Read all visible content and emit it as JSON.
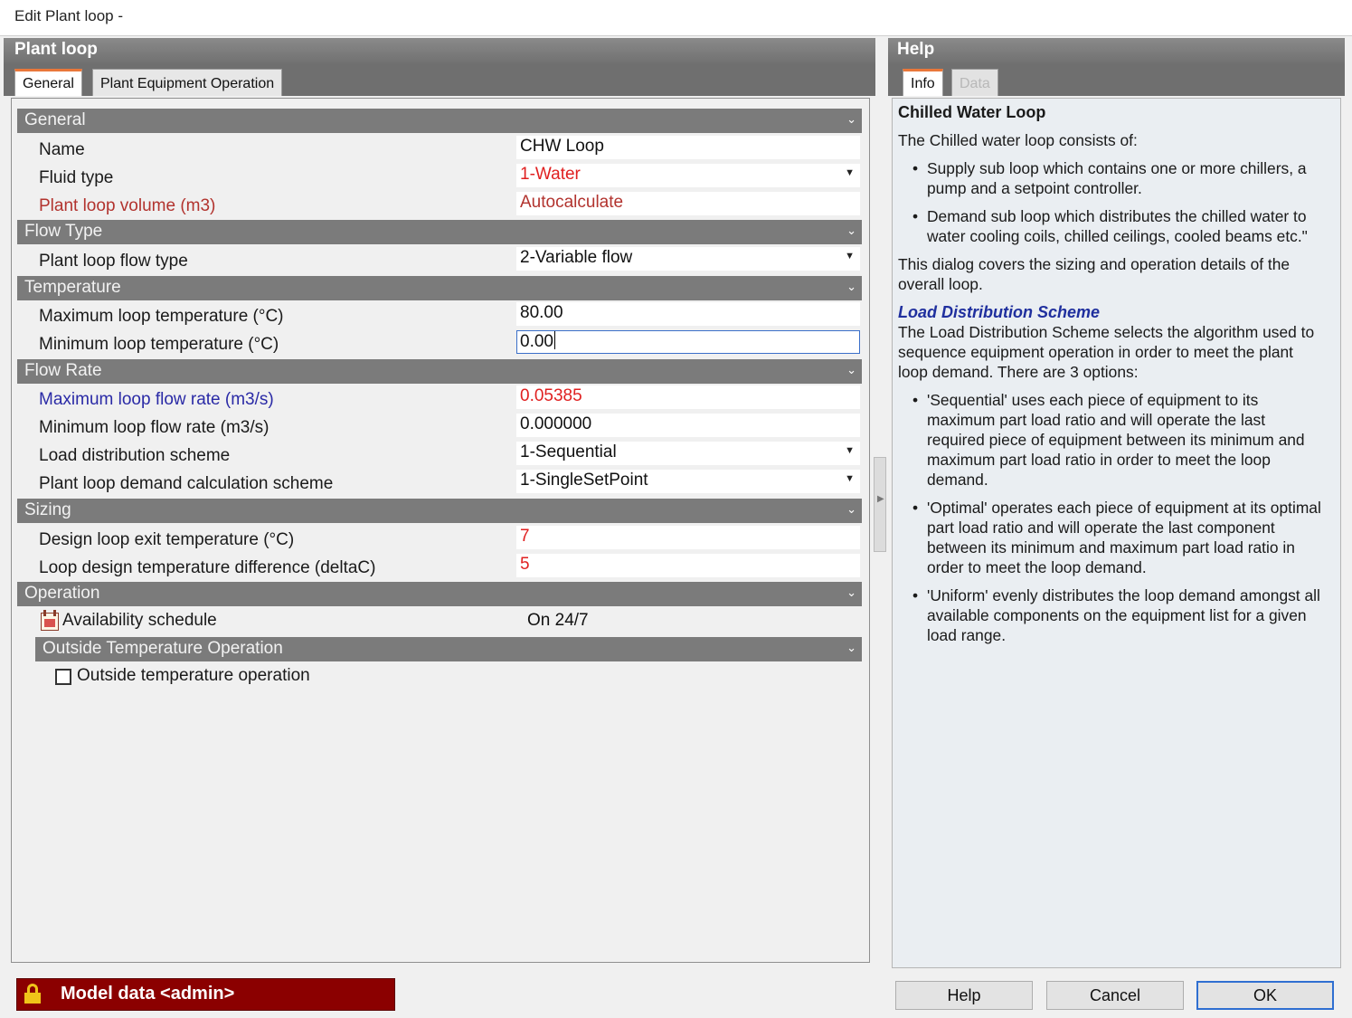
{
  "window": {
    "title": "Edit Plant loop -"
  },
  "left_pane": {
    "header": "Plant loop",
    "tabs": [
      {
        "label": "General",
        "active": true
      },
      {
        "label": "Plant Equipment Operation",
        "active": false
      }
    ]
  },
  "form": {
    "general": {
      "title": "General",
      "name": {
        "label": "Name",
        "value": "CHW Loop"
      },
      "fluid_type": {
        "label": "Fluid type",
        "value": "1-Water"
      },
      "volume": {
        "label": "Plant loop volume (m3)",
        "value": "Autocalculate"
      }
    },
    "flow_type": {
      "title": "Flow Type",
      "loop_flow_type": {
        "label": "Plant loop flow type",
        "value": "2-Variable flow"
      }
    },
    "temperature": {
      "title": "Temperature",
      "max_temp": {
        "label": "Maximum loop temperature (°C)",
        "value": "80.00"
      },
      "min_temp": {
        "label": "Minimum loop temperature (°C)",
        "value": "0.00"
      }
    },
    "flow_rate": {
      "title": "Flow Rate",
      "max_flow": {
        "label": "Maximum loop flow rate (m3/s)",
        "value": "0.05385"
      },
      "min_flow": {
        "label": "Minimum loop flow rate (m3/s)",
        "value": "0.000000"
      },
      "load_scheme": {
        "label": "Load distribution scheme",
        "value": "1-Sequential"
      },
      "demand_scheme": {
        "label": "Plant loop demand calculation scheme",
        "value": "1-SingleSetPoint"
      }
    },
    "sizing": {
      "title": "Sizing",
      "exit_temp": {
        "label": "Design loop exit temperature (°C)",
        "value": "7"
      },
      "delta_t": {
        "label": "Loop design temperature difference (deltaC)",
        "value": "5"
      }
    },
    "operation": {
      "title": "Operation",
      "availability": {
        "label": "Availability schedule",
        "value": "On 24/7"
      },
      "outside_temp_section": "Outside Temperature Operation",
      "outside_temp_checkbox": {
        "label": "Outside temperature operation",
        "checked": false
      }
    }
  },
  "right_pane": {
    "header": "Help",
    "tabs": [
      {
        "label": "Info",
        "active": true
      },
      {
        "label": "Data",
        "active": false
      }
    ]
  },
  "help": {
    "title": "Chilled Water Loop",
    "intro": "The Chilled water loop consists of:",
    "components": [
      "Supply sub loop which contains one or more chillers, a pump and a setpoint controller.",
      "Demand sub loop which distributes the chilled water to water cooling coils, chilled ceilings, cooled beams etc.\""
    ],
    "dialog_note": "This dialog covers the sizing and operation details of the overall loop.",
    "subheading": "Load Distribution Scheme",
    "scheme_intro": "The Load Distribution Scheme selects the algorithm used to sequence equipment operation in order to meet the plant loop demand. There are 3 options:",
    "options": [
      "'Sequential' uses each piece of equipment to its maximum part load ratio and will operate the last required piece of equipment between its minimum and maximum part load ratio in order to meet the loop demand.",
      "'Optimal' operates each piece of equipment at its optimal part load ratio and will operate the last component between its minimum and maximum part load ratio in order to meet the loop demand.",
      "'Uniform' evenly distributes the loop demand amongst all available components on the equipment list for a given load range."
    ]
  },
  "footer": {
    "status": "Model data <admin>",
    "buttons": {
      "help": "Help",
      "cancel": "Cancel",
      "ok": "OK"
    }
  },
  "colors": {
    "status_bar": "#8b0000",
    "section_bar": "#7b7b7b",
    "tab_accent": "#e9773a",
    "highlight_red": "#e02020",
    "label_red": "#b2332e",
    "label_blue": "#2a2aa6",
    "help_subhead": "#1f2f9e"
  }
}
